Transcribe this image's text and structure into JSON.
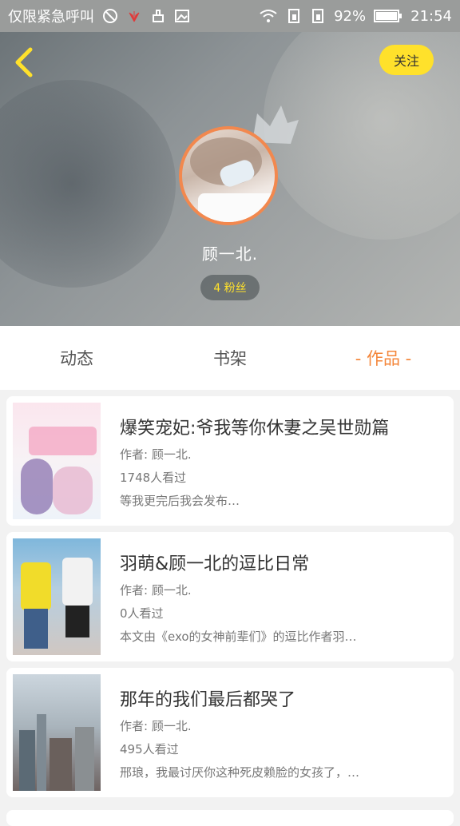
{
  "status_bar": {
    "carrier_text": "仅限紧急呼叫",
    "battery": "92%",
    "time": "21:54"
  },
  "header": {
    "follow_label": "关注",
    "username": "顾一北.",
    "fans_label": "4 粉丝"
  },
  "tabs": [
    {
      "label": "动态"
    },
    {
      "label": "书架"
    },
    {
      "label": "- 作品 -"
    }
  ],
  "active_tab": "作品",
  "works": [
    {
      "title": "爆笑宠妃:爷我等你休妻之吴世勋篇",
      "author": "作者: 顾一北.",
      "views": "1748人看过",
      "summary": "等我更完后我会发布…"
    },
    {
      "title": "羽萌&顾一北的逗比日常",
      "author": "作者: 顾一北.",
      "views": "0人看过",
      "summary": "本文由《exo的女神前辈们》的逗比作者羽…"
    },
    {
      "title": "那年的我们最后都哭了",
      "author": "作者: 顾一北.",
      "views": "495人看过",
      "summary": "邢琅，我最讨厌你这种死皮赖脸的女孩了，…"
    }
  ],
  "colors": {
    "accent": "#f4863a",
    "follow_button": "#ffe12b",
    "avatar_ring": "#f2884e"
  }
}
